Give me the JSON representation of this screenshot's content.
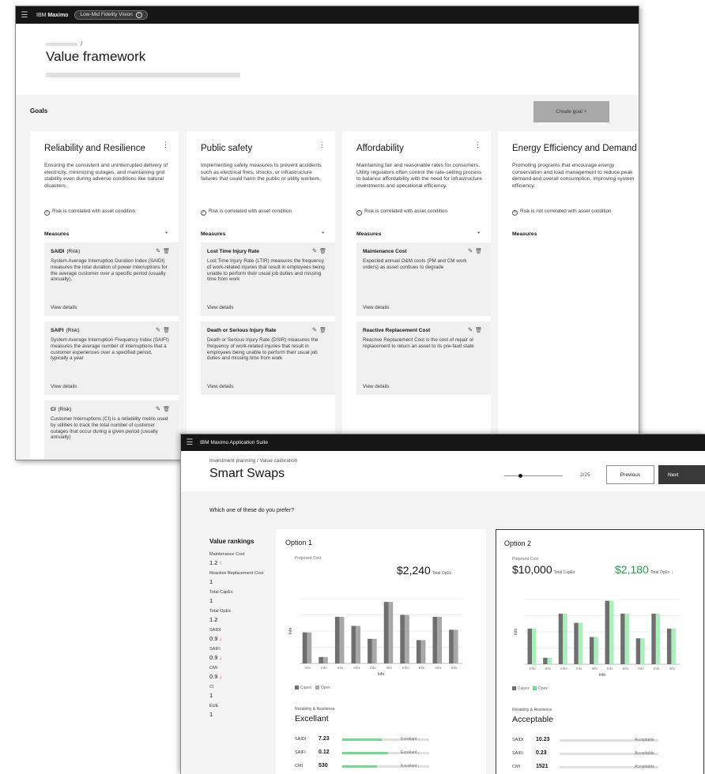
{
  "window1": {
    "brand_pre": "IBM ",
    "brand_name": "Maximo",
    "tag": "Low-Mid Fidelity Vision",
    "breadcrumb_sep": "/",
    "title": "Value framework",
    "goals_heading": "Goals",
    "create_goal": "Create goal +",
    "measures_heading": "Measures",
    "view_details": "View details",
    "goals": [
      {
        "title": "Reliability and Resilience",
        "description": "Ensuring the consistent and uninterrupted delivery of electricity, minimizing outages, and maintaining grid stability even during adverse conditions like natural disasters.",
        "risk": "Risk is correlated with asset condition",
        "risk_icon": "check",
        "measures": [
          {
            "name": "SAIDI",
            "suffix": "(Risk)",
            "description": "System Average Interruption Duration Index (SAIDI) measures the total duration of power interruptions for the average customer over a specific period (usually annually)."
          },
          {
            "name": "SAIFI",
            "suffix": "(Risk)",
            "description": "System Average Interruption Frequency Index (SAIFI) measures the average number of interruptions that a customer experiences over a specified period, typically a year"
          },
          {
            "name": "CI",
            "suffix": "(Risk)",
            "description": "Customer Interruptions (CI) is a reliability metric used by utilities to track the total number of customer outages that occur during a given period (usually annually)"
          }
        ]
      },
      {
        "title": "Public safety",
        "description": "Implementing safety measures to prevent accidents such as electrical fires, shocks, or infrastructure failures that could harm the public or utility workers.",
        "risk": "Risk is correlated with asset condition",
        "risk_icon": "check",
        "measures": [
          {
            "name": "Lost Time Injury Rate",
            "suffix": "",
            "description": "Lost Time Injury Rate (LTIR) measures the frequency of work-related injuries that result in employees being unable to perform their usual job duties and missing time from work"
          },
          {
            "name": "Death or Serious Injury Rate",
            "suffix": "",
            "description": "Death or Serious Injury Rate (DSIR) measures the frequency of work-related injuries that result in employees being unable to perform their usual job duties and missing time from work"
          }
        ]
      },
      {
        "title": "Affordability",
        "description": "Maintaining fair and reasonable rates for consumers. Utility regulators often control the rate-setting process to balance affordability with the need for infrastructure investments and operational efficiency.",
        "risk": "Risk is correlated with asset condition",
        "risk_icon": "check",
        "measures": [
          {
            "name": "Maintenance Cost",
            "suffix": "",
            "description": "Expected annual O&M costs (PM and CM work orders) as asset contiues to degrade"
          },
          {
            "name": "Reactive Replacement Cost",
            "suffix": "",
            "description": "Reactive Replacement Cost is the cost of repair or replacement to return an asset to its pre-fault state"
          }
        ]
      },
      {
        "title": "Energy Efficiency and Demand",
        "description": "Promoting programs that encourage energy conservation and load management to reduce peak demand and overall consumption, improving system efficiency.",
        "risk": "Risk is not correlated with asset condition",
        "risk_icon": "x",
        "measures": []
      }
    ]
  },
  "window2": {
    "brand": "IBM Maximo Application Suite",
    "breadcrumb": "Investment planning  /  Value calibration",
    "title": "Smart Swaps",
    "progress": "2/25",
    "progress_fraction": 0.08,
    "previous": "Previous",
    "next": "Next",
    "question": "Which one of these do you prefer?",
    "rankings_heading": "Value rankings",
    "rankings": [
      {
        "label": "Maintenance Cost",
        "value": "1.2",
        "trend": "up"
      },
      {
        "label": "Reactive Replacement Cost",
        "value": "1",
        "trend": ""
      },
      {
        "label": "Total CapEx",
        "value": "1",
        "trend": ""
      },
      {
        "label": "Total OpEx",
        "value": "1.2",
        "trend": "up"
      },
      {
        "label": "SAIDI",
        "value": "0.9",
        "trend": "down"
      },
      {
        "label": "SAIFI",
        "value": "0.9",
        "trend": "down"
      },
      {
        "label": "CMI",
        "value": "0.9",
        "trend": "down"
      },
      {
        "label": "CI",
        "value": "1",
        "trend": ""
      },
      {
        "label": "EUE",
        "value": "1",
        "trend": ""
      }
    ],
    "options": [
      {
        "title": "Option 1",
        "cost_label": "Proposed Cost",
        "capex": "",
        "capex_label": "",
        "opex": "$2,240",
        "opex_label": "Total OpEx",
        "opex_trend": "",
        "opex_color": "#161616",
        "rr_label": "Reliability & Resilience",
        "rr_value": "Excellant",
        "legend": [
          "Capex",
          "Opex"
        ],
        "rows": [
          {
            "name": "SAIDI",
            "value": "7.23",
            "tag": "Excellant",
            "level": 0.45,
            "trend": "down"
          },
          {
            "name": "SAIFI",
            "value": "0.12",
            "tag": "Excellant",
            "level": 0.53,
            "trend": "down"
          },
          {
            "name": "CMI",
            "value": "530",
            "tag": "Excellant",
            "level": 0.4,
            "trend": "down"
          }
        ]
      },
      {
        "title": "Option 2",
        "cost_label": "Proposed Cost",
        "capex": "$10,000",
        "capex_label": "Total CapEx",
        "opex": "$2,180",
        "opex_label": "Total OpEx",
        "opex_trend": "down",
        "opex_color": "#24a148",
        "rr_label": "Reliability & Resilience",
        "rr_value": "Acceptable",
        "legend": [
          "Capex",
          "Opex"
        ],
        "rows": [
          {
            "name": "SAIDI",
            "value": "10.23",
            "tag": "Acceptable",
            "level": 0,
            "trend": ""
          },
          {
            "name": "SAIFI",
            "value": "0.23",
            "tag": "Acceptable",
            "level": 0,
            "trend": ""
          },
          {
            "name": "CMI",
            "value": "1521",
            "tag": "Acceptable",
            "level": 0,
            "trend": ""
          }
        ]
      }
    ]
  },
  "chart_data": [
    {
      "type": "bar",
      "title": "",
      "xlabel": "Info",
      "ylabel": "Info",
      "categories": [
        "Info",
        "Info",
        "Info",
        "Info",
        "Info",
        "Info",
        "Info",
        "Info",
        "Info",
        "Info"
      ],
      "series": [
        {
          "name": "Capex",
          "values": [
            48,
            10,
            72,
            58,
            38,
            95,
            75,
            36,
            72,
            52
          ]
        },
        {
          "name": "Opex",
          "values": [
            48,
            10,
            72,
            58,
            38,
            95,
            75,
            36,
            72,
            52
          ]
        }
      ],
      "colors": [
        "#6f6f6f",
        "#a8a8a8"
      ],
      "ylim": [
        0,
        100
      ],
      "grid": true,
      "legend": "bottom-left"
    },
    {
      "type": "bar",
      "title": "",
      "xlabel": "Info",
      "ylabel": "Info",
      "categories": [
        "Info",
        "Info",
        "Info",
        "Info",
        "Info",
        "Info",
        "Info",
        "Info",
        "Info",
        "Info"
      ],
      "series": [
        {
          "name": "Capex",
          "values": [
            55,
            10,
            78,
            64,
            42,
            98,
            78,
            40,
            78,
            55
          ]
        },
        {
          "name": "Opex",
          "values": [
            55,
            10,
            78,
            64,
            42,
            98,
            78,
            40,
            78,
            55
          ]
        }
      ],
      "colors": [
        "#6f6f6f",
        "#a7f0ba"
      ],
      "ylim": [
        0,
        100
      ],
      "grid": true,
      "legend": "bottom-left"
    }
  ]
}
